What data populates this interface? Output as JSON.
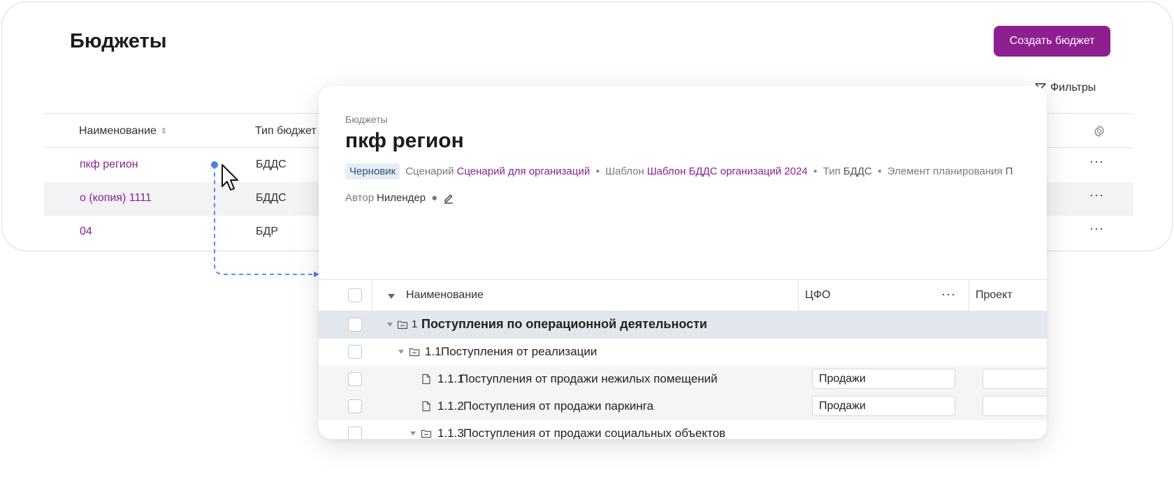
{
  "list_page": {
    "title": "Бюджеты",
    "create_button": "Создать бюджет",
    "filters_label": "Фильтры",
    "columns": {
      "name": "Наименование",
      "type": "Тип бюджет"
    },
    "rows": [
      {
        "name": "пкф регион",
        "type": "БДДС"
      },
      {
        "name": "о (копия) 1111",
        "type": "БДДС"
      },
      {
        "name": "04",
        "type": "БДР"
      }
    ],
    "more_glyph": "···"
  },
  "detail": {
    "breadcrumb": "Бюджеты",
    "title": "пкф регион",
    "status_badge": "Черновик",
    "scenario_label": "Сценарий",
    "scenario_value": "Сценарий для организаций",
    "template_label": "Шаблон",
    "template_value": "Шаблон БДДС организаций 2024",
    "type_label": "Тип",
    "type_value": "БДДС",
    "planning_label": "Элемент планирования",
    "planning_value": "П",
    "author_label": "Автор",
    "author_value": "Нилендер",
    "grid": {
      "columns": {
        "name": "Наименование",
        "cfo": "ЦФО",
        "project": "Проект"
      },
      "rows": [
        {
          "num": "1",
          "name": "Поступления по операционной деятельности",
          "cfo": ""
        },
        {
          "num": "1.1",
          "name": "Поступления от реализации",
          "cfo": ""
        },
        {
          "num": "1.1.1",
          "name": "Поступления от продажи нежилых помещений",
          "cfo": "Продажи"
        },
        {
          "num": "1.1.2",
          "name": "Поступления от продажи паркинга",
          "cfo": "Продажи"
        },
        {
          "num": "1.1.3",
          "name": "Поступления от продажи социальных объектов",
          "cfo": ""
        }
      ]
    }
  },
  "colors": {
    "accent": "#8e1f8f",
    "connector": "#4a7ef0",
    "selected_row": "#e2e7ee"
  }
}
